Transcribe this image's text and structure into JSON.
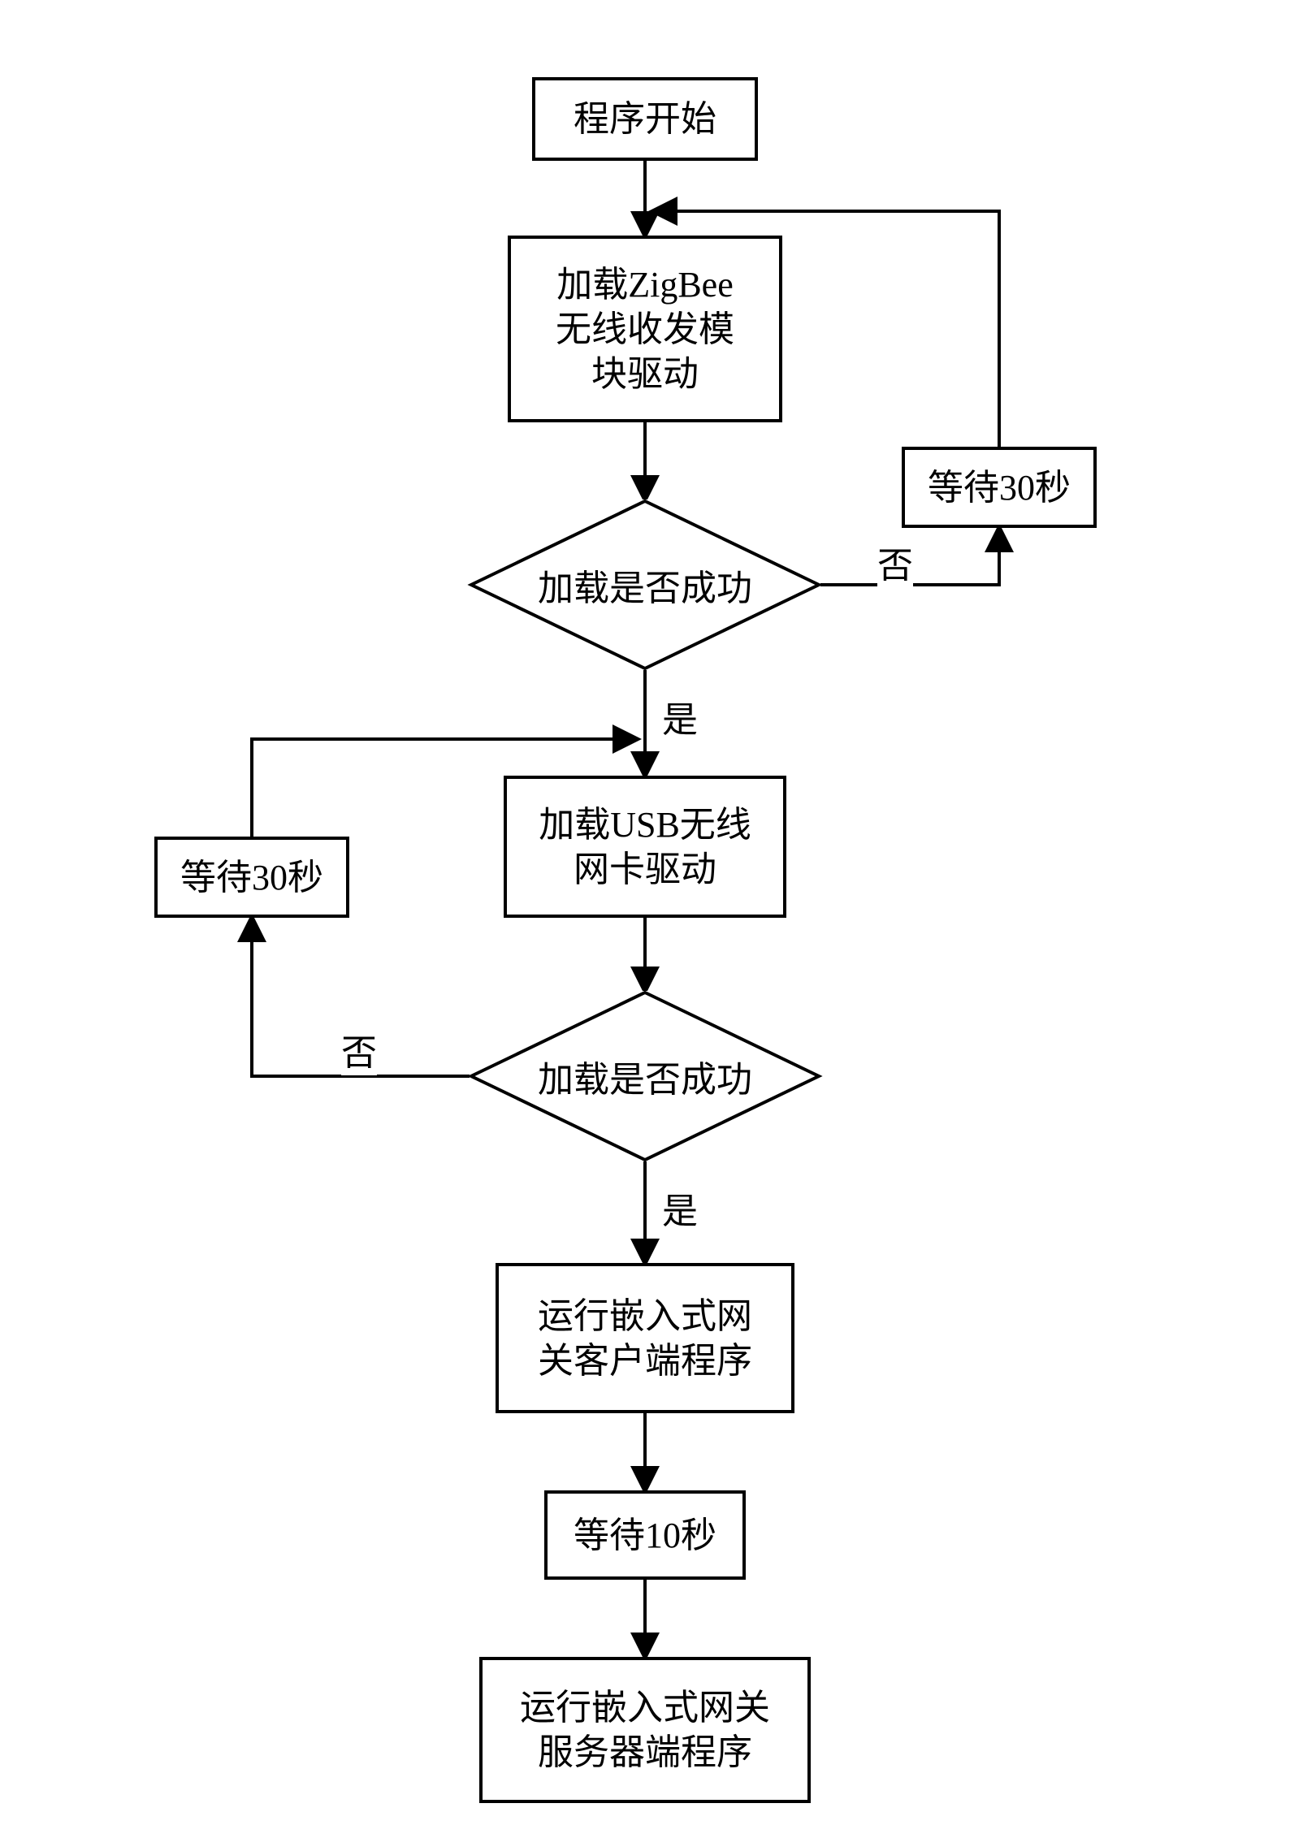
{
  "nodes": {
    "start": "程序开始",
    "loadZigbee": "加载ZigBee\n无线收发模\n块驱动",
    "dec1": "加载是否成功",
    "wait30a": "等待30秒",
    "loadUSB": "加载USB无线\n网卡驱动",
    "dec2": "加载是否成功",
    "wait30b": "等待30秒",
    "runClient": "运行嵌入式网\n关客户端程序",
    "wait10": "等待10秒",
    "runServer": "运行嵌入式网关\n服务器端程序"
  },
  "labels": {
    "yes": "是",
    "no": "否"
  }
}
